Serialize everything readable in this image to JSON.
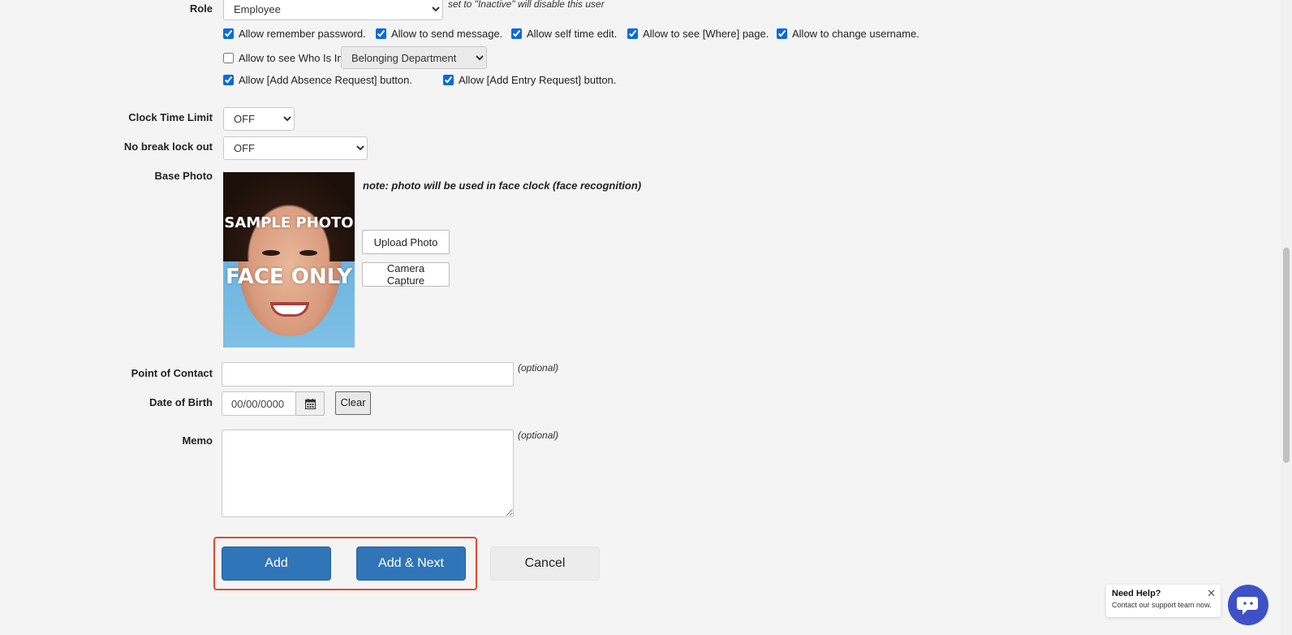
{
  "role": {
    "label": "Role",
    "value": "Employee",
    "note": "set to \"Inactive\" will disable this user"
  },
  "permissions": {
    "remember_password": {
      "label": "Allow remember password.",
      "checked": true
    },
    "send_message": {
      "label": "Allow to send message.",
      "checked": true
    },
    "self_time_edit": {
      "label": "Allow self time edit.",
      "checked": true
    },
    "where_page": {
      "label": "Allow to see [Where] page.",
      "checked": true
    },
    "change_username": {
      "label": "Allow to change username.",
      "checked": true
    },
    "who_is_in": {
      "label": "Allow to see Who Is In.",
      "checked": false
    },
    "who_is_in_scope": "Belonging Department",
    "add_absence": {
      "label": "Allow [Add Absence Request] button.",
      "checked": true
    },
    "add_entry": {
      "label": "Allow [Add Entry Request] button.",
      "checked": true
    }
  },
  "clock_time_limit": {
    "label": "Clock Time Limit",
    "value": "OFF"
  },
  "no_break_lockout": {
    "label": "No break lock out",
    "value": "OFF"
  },
  "base_photo": {
    "label": "Base Photo",
    "note": "note: photo will be used in face clock (face recognition)",
    "overlay_line1": "SAMPLE PHOTO",
    "overlay_line2": "FACE ONLY",
    "upload_label": "Upload Photo",
    "camera_label": "Camera Capture"
  },
  "point_of_contact": {
    "label": "Point of Contact",
    "value": "",
    "hint": "(optional)"
  },
  "date_of_birth": {
    "label": "Date of Birth",
    "value": "00/00/0000",
    "clear_label": "Clear"
  },
  "memo": {
    "label": "Memo",
    "value": "",
    "hint": "(optional)"
  },
  "actions": {
    "add": "Add",
    "add_next": "Add & Next",
    "cancel": "Cancel",
    "highlight_color": "#e04a32",
    "primary_color": "#2f75b8"
  },
  "help": {
    "title": "Need Help?",
    "subtitle": "Contact our support team now.",
    "close": "✕"
  }
}
